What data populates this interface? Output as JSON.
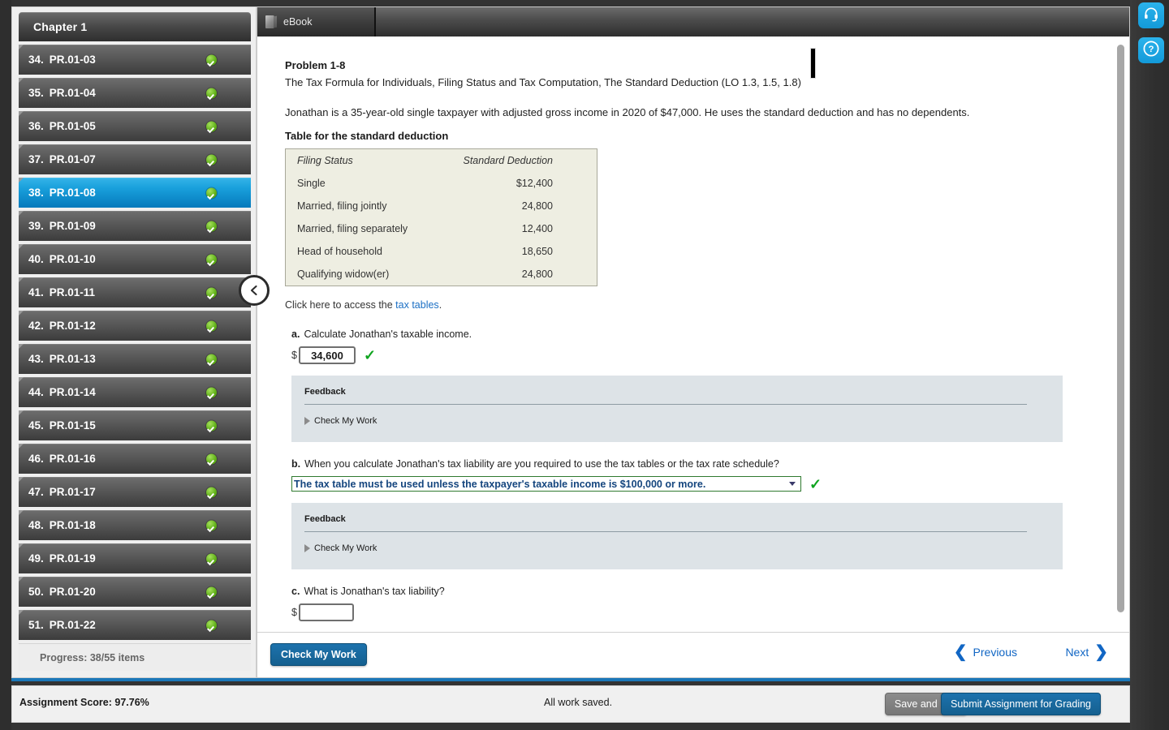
{
  "sidebar": {
    "header_title": "Chapter 1",
    "items": [
      {
        "num": "34.",
        "code": "PR.01-03",
        "status": "complete"
      },
      {
        "num": "35.",
        "code": "PR.01-04",
        "status": "complete"
      },
      {
        "num": "36.",
        "code": "PR.01-05",
        "status": "complete"
      },
      {
        "num": "37.",
        "code": "PR.01-07",
        "status": "complete"
      },
      {
        "num": "38.",
        "code": "PR.01-08",
        "status": "complete"
      },
      {
        "num": "39.",
        "code": "PR.01-09",
        "status": "complete"
      },
      {
        "num": "40.",
        "code": "PR.01-10",
        "status": "complete"
      },
      {
        "num": "41.",
        "code": "PR.01-11",
        "status": "complete"
      },
      {
        "num": "42.",
        "code": "PR.01-12",
        "status": "complete"
      },
      {
        "num": "43.",
        "code": "PR.01-13",
        "status": "complete"
      },
      {
        "num": "44.",
        "code": "PR.01-14",
        "status": "complete"
      },
      {
        "num": "45.",
        "code": "PR.01-15",
        "status": "complete"
      },
      {
        "num": "46.",
        "code": "PR.01-16",
        "status": "complete"
      },
      {
        "num": "47.",
        "code": "PR.01-17",
        "status": "complete"
      },
      {
        "num": "48.",
        "code": "PR.01-18",
        "status": "complete"
      },
      {
        "num": "49.",
        "code": "PR.01-19",
        "status": "complete"
      },
      {
        "num": "50.",
        "code": "PR.01-20",
        "status": "complete"
      },
      {
        "num": "51.",
        "code": "PR.01-22",
        "status": "complete"
      }
    ],
    "selected_index": 4,
    "progress_label": "Progress:  38/55 items",
    "collapse_icon": "chevron-left-icon"
  },
  "tabs": [
    {
      "label": "eBook",
      "icon": "book-icon",
      "active": true
    }
  ],
  "problem": {
    "title": "Problem 1-8",
    "subtitle": "The Tax Formula for Individuals, Filing Status and Tax Computation, The Standard Deduction (LO 1.3, 1.5, 1.8)",
    "body": "Jonathan is a 35-year-old single taxpayer with adjusted gross income in 2020 of $47,000. He uses the standard deduction and has no dependents.",
    "table_caption": "Table for the standard deduction",
    "table": {
      "headers": [
        "Filing Status",
        "Standard Deduction"
      ],
      "rows": [
        [
          "Single",
          "$12,400"
        ],
        [
          "Married, filing jointly",
          "24,800"
        ],
        [
          "Married, filing separately",
          "12,400"
        ],
        [
          "Head of household",
          "18,650"
        ],
        [
          "Qualifying widow(er)",
          "24,800"
        ]
      ]
    },
    "access_prefix": "Click here to access the ",
    "access_link": "tax tables",
    "access_suffix": "."
  },
  "questions": [
    {
      "letter": "a.",
      "text": "Calculate Jonathan's taxable income.",
      "input_type": "text",
      "currency_prefix": "$",
      "value": "34,600",
      "correct_mark": "✓",
      "feedback": {
        "title": "Feedback",
        "check_my_work": "Check My Work"
      }
    },
    {
      "letter": "b.",
      "text": "When you calculate Jonathan's tax liability are you required to use the tax tables or the tax rate schedule?",
      "input_type": "select",
      "value": "The tax table must be used unless the taxpayer's taxable income is $100,000 or more.",
      "correct_mark": "✓",
      "feedback": {
        "title": "Feedback",
        "check_my_work": "Check My Work"
      }
    },
    {
      "letter": "c.",
      "text": "What is Jonathan's tax liability?",
      "input_type": "text",
      "currency_prefix": "$",
      "value": ""
    }
  ],
  "action_bar": {
    "check_my_work": "Check My Work",
    "previous": "Previous",
    "next": "Next",
    "prev_chevron": "❮",
    "next_chevron": "❯"
  },
  "status_bar": {
    "score_label": "Assignment Score:  97.76%",
    "saved_label": "All work saved.",
    "save_exit": "Save and Exit",
    "submit": "Submit Assignment for Grading"
  },
  "right_rail": [
    {
      "name": "support-headset-icon"
    },
    {
      "name": "help-question-icon"
    }
  ],
  "colors": {
    "accent_blue": "#1b77b8",
    "selected_item": "#19a0dc",
    "correct_green": "#0fa41f",
    "table_bg": "#eeeee2",
    "feedback_bg": "#dde3e7",
    "link_blue": "#1b6fc4"
  }
}
